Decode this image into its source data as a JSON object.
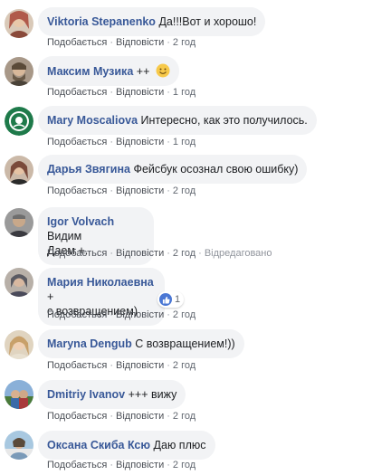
{
  "labels": {
    "like": "Подобається",
    "reply": "Відповісти",
    "edited": "Відредаговано"
  },
  "comments": [
    {
      "author": "Viktoria Stepanenko",
      "text": "Да!!!Вот и хорошо!",
      "time": "2 год",
      "avatar_icon": "user-avatar-icon",
      "avatar_color": "#b05a4a"
    },
    {
      "author": "Максим Музика",
      "text": "++",
      "emoji": "smile-emoji-icon",
      "time": "1 год",
      "avatar_icon": "user-avatar-icon",
      "avatar_color": "#6a5a48"
    },
    {
      "author": "Mary Moscaliova",
      "text": "Интересно, как это получилось.",
      "time": "1 год",
      "avatar_icon": "starbucks-logo-icon",
      "avatar_color": "#1e7a4a"
    },
    {
      "author": "Дарья Звягина",
      "text": "Фейсбук осознал свою ошибку)",
      "time": "2 год",
      "avatar_icon": "user-avatar-icon",
      "avatar_color": "#7a4a3a"
    },
    {
      "author": "Igor Volvach",
      "text_line1": "Видим",
      "text_line2": "Даем +.",
      "time": "2 год",
      "edited": true,
      "avatar_icon": "user-avatar-icon",
      "avatar_color": "#6e6e6e"
    },
    {
      "author": "Мария Николаевна",
      "text_line1": "+",
      "text_line2": "с возвращением)",
      "time": "2 год",
      "reaction_count": "1",
      "avatar_icon": "user-avatar-icon",
      "avatar_color": "#5a5a62"
    },
    {
      "author": "Maryna Dengub",
      "text": "С возвращением!))",
      "time": "2 год",
      "avatar_icon": "user-avatar-icon",
      "avatar_color": "#c8a06a"
    },
    {
      "author": "Dmitriy Ivanov",
      "text": "+++ вижу",
      "time": "2 год",
      "avatar_icon": "user-avatar-icon",
      "avatar_color": "#3a6aa8"
    },
    {
      "author": "Оксана Скиба Ксю",
      "text": "Даю плюс",
      "time": "2 год",
      "avatar_icon": "user-avatar-icon",
      "avatar_color": "#7a9ab8"
    }
  ],
  "colors": {
    "link": "#385898",
    "bubble": "#f2f3f5",
    "meta": "#616770",
    "like_blue": "#4a77d4"
  }
}
